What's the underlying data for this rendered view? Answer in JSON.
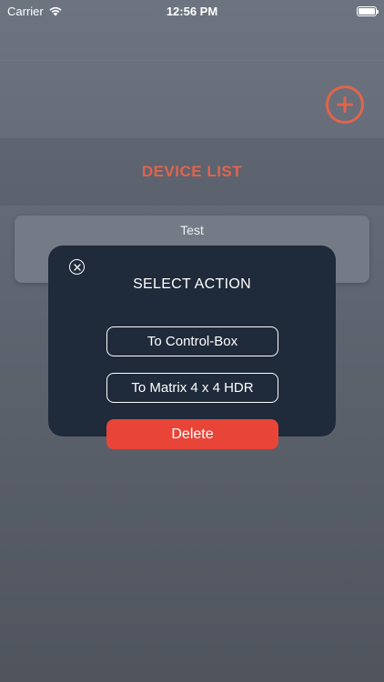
{
  "status_bar": {
    "carrier": "Carrier",
    "time": "12:56 PM"
  },
  "header": {
    "add_icon": "plus-circle-icon",
    "accent_color": "#e2644a"
  },
  "device_list": {
    "title": "DEVICE LIST",
    "items": [
      {
        "name": "Test"
      }
    ]
  },
  "modal": {
    "title": "SELECT ACTION",
    "close_icon": "close-icon",
    "actions": [
      {
        "label": "To Control-Box"
      },
      {
        "label": "To Matrix 4 x 4 HDR"
      }
    ],
    "delete_label": "Delete",
    "delete_color": "#e84538",
    "background_color": "#1f2a3a"
  }
}
